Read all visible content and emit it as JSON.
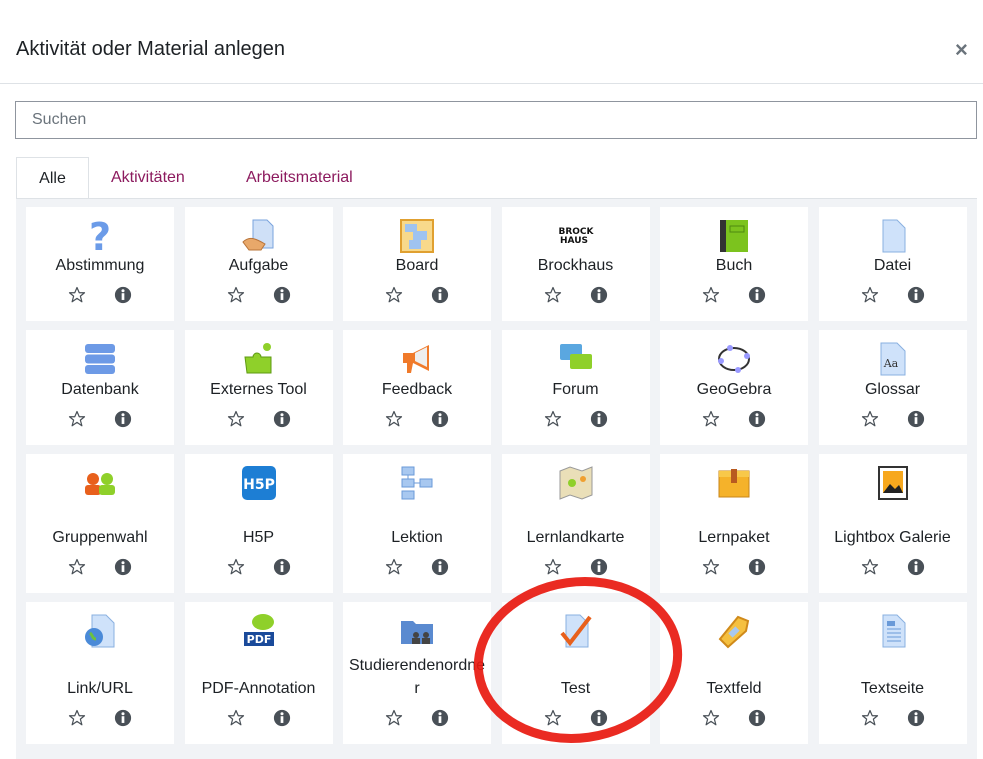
{
  "dialog": {
    "title": "Aktivität oder Material anlegen",
    "close_label": "×"
  },
  "search": {
    "placeholder": "Suchen",
    "value": ""
  },
  "tabs": [
    {
      "label": "Alle",
      "active": true
    },
    {
      "label": "Aktivitäten",
      "active": false
    },
    {
      "label": "Arbeitsmaterial",
      "active": false
    }
  ],
  "colors": {
    "tab_link": "#8c1a5e",
    "annotation_circle": "#e8190f"
  },
  "modules": [
    {
      "name": "Abstimmung",
      "icon": "question-icon"
    },
    {
      "name": "Aufgabe",
      "icon": "assignment-icon"
    },
    {
      "name": "Board",
      "icon": "board-icon"
    },
    {
      "name": "Brockhaus",
      "icon": "brockhaus-logo-icon",
      "icon_text": "BROCK HAUS"
    },
    {
      "name": "Buch",
      "icon": "book-icon"
    },
    {
      "name": "Datei",
      "icon": "file-icon"
    },
    {
      "name": "Datenbank",
      "icon": "database-icon"
    },
    {
      "name": "Externes Tool",
      "icon": "puzzle-icon"
    },
    {
      "name": "Feedback",
      "icon": "megaphone-icon"
    },
    {
      "name": "Forum",
      "icon": "forum-icon"
    },
    {
      "name": "GeoGebra",
      "icon": "geogebra-icon"
    },
    {
      "name": "Glossar",
      "icon": "glossary-icon"
    },
    {
      "name": "Gruppenwahl",
      "icon": "group-choice-icon"
    },
    {
      "name": "H5P",
      "icon": "h5p-icon",
      "icon_text": "H5P"
    },
    {
      "name": "Lektion",
      "icon": "lesson-icon"
    },
    {
      "name": "Lernlandkarte",
      "icon": "map-icon"
    },
    {
      "name": "Lernpaket",
      "icon": "package-icon"
    },
    {
      "name": "Lightbox Galerie",
      "icon": "image-gallery-icon"
    },
    {
      "name": "Link/URL",
      "icon": "url-icon"
    },
    {
      "name": "PDF-Annotation",
      "icon": "pdf-annotation-icon",
      "icon_text": "PDF"
    },
    {
      "name": "Studierendenordner",
      "icon": "student-folder-icon"
    },
    {
      "name": "Test",
      "icon": "quiz-icon",
      "highlighted": true
    },
    {
      "name": "Textfeld",
      "icon": "label-tag-icon"
    },
    {
      "name": "Textseite",
      "icon": "page-icon"
    }
  ]
}
